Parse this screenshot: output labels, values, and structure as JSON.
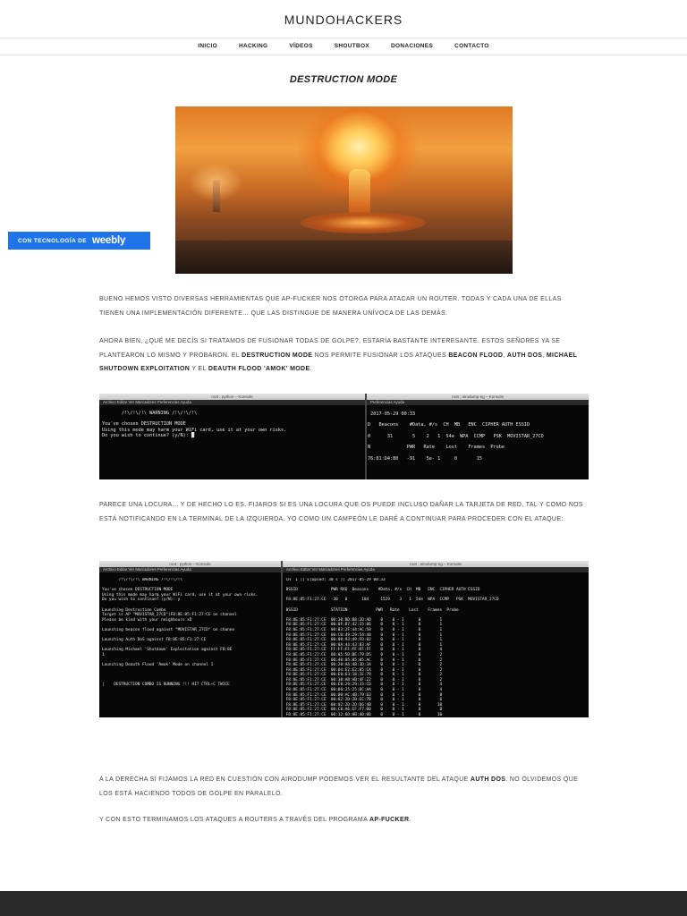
{
  "site": {
    "title": "MUNDOHACKERS"
  },
  "nav": [
    {
      "label": "INICIO"
    },
    {
      "label": "HACKING"
    },
    {
      "label": "VÍDEOS"
    },
    {
      "label": "SHOUTBOX"
    },
    {
      "label": "DONACIONES"
    },
    {
      "label": "CONTACTO"
    }
  ],
  "page": {
    "heading": "DESTRUCTION MODE"
  },
  "badge": {
    "prefix": "CON TECNOLOGÍA DE",
    "brand": "weebly",
    "color": "#1e74e8"
  },
  "paragraphs": {
    "p1": "Bueno hemos visto diversas herramientas que AP-Fucker nos otorga para atacar un router. Todas y cada una de ellas tienen una implementación diferente... que las distingue de manera unívoca de las demás.",
    "p2a": "Ahora bien, ¿qué me decís si tratamos de fusionar todas de golpe?, estaría bastante interesante. Estos señores ya se plantearon lo mismo y probaron. El ",
    "p2b": "Destruction Mode",
    "p2c": " nos permite fusionar los ataques ",
    "p2d": "Beacon Flood",
    "p2e": ", ",
    "p2f": "Auth DoS",
    "p2g": ", ",
    "p2h": "Michael Shutdown Exploitation",
    "p2i": " y el ",
    "p2j": "Deauth Flood 'Amok' Mode",
    "p2k": ".",
    "p3": "Parece una locura... y de hecho lo es. Fijaros si es una locura que os puede incluso dañar la tarjeta de red, tal y como nos está notificando en la terminal de la izquierda. Yo como un campeón le daré a continuar para proceder con el ataque:",
    "p4a": "A la derecha si fijamos la red en cuestión con airodump podemos ver el resultante del ataque ",
    "p4b": "Auth DoS",
    "p4c": ". No olvidemos que los está haciendo todos de golpe en paralelo.",
    "p5a": "Y con esto terminamos los ataques a routers a través del programa ",
    "p5b": "AP-Fucker",
    "p5c": "."
  },
  "term1": {
    "left_title": "root : python – Konsole",
    "right_title": "root : airodump-ng – Konsole",
    "left_menu": "Archivo   Editar   Ver   Marcadores   Preferencias   Ayuda",
    "right_menu": "Preferencias   Ayuda",
    "left_text": "       /!\\/!\\/!\\ WARNING /!\\/!\\/!\\\n\nYou've chosen DESTRUCTION MODE\nUsing this mode may harm your WiFi card, use it at your own risks.\nDo you wish to continue? (y/N): █",
    "right_text": " 2017-05-29 00:33\n\nD   Beacons    #Data, #/s  CH  MB   ENC  CIPHER AUTH ESSID\n\n0      31       5    2   1  54e  WPA  CCMP   PSK  MOVISTAR_27CD\n\nN             PWR   Rate    Lost    Frames  Probe\n\n76:81:D4:B0   -91    5e- 1     0       15"
  },
  "term2": {
    "left_title": "root : python – Konsole",
    "right_title": "root : airodump-ng – Konsole",
    "left_menu": "Archivo   Editar   Ver   Marcadores   Preferencias   Ayuda",
    "right_menu": "Archivo   Editar   Ver   Marcadores   Preferencias   Ayuda",
    "left_text": "       /!\\/!\\/!\\ WARNING /!\\/!\\/!\\\n\nYou've chosen DESTRUCTION MODE\nUsing this mode may harm your WiFi card, use it at your own risks.\nDo you wish to continue? (y/N): y\n\nLaunching Destruction Combo\nTarget is AP \"MOVISTAR_27CD\"(F8:8E:85:F1:27:CE on channel\nPlease be kind with your neighbours xD\n\nLaunching beacon flood against \"MOVISTAR_27CD\" on channe\n\nLaunching Auth DoS against F8:8E:85:F1:27:CE\n\nLaunching Michael 'Shutdown' Exploitation against F8:8E\n1\n\nLaunching Deauth Flood 'Amok' Mode on channel 1\n\n\n\n|    DESTRUCTION COMBO IS RUNNING !!! HIT CTRL+C TWICE",
    "right_text": " CH  1 ][ Elapsed: 30 s ][ 2017-05-29 00:33\n\n BSSID              PWR RXQ  Beacons    #Data, #/s  CH  MB   ENC  CIPHER AUTH ESSID\n\n F8:8E:85:F1:27:CE  -30   0      104     1529    3   1  54e  WPA  CCMP   PSK  MOVISTAR_27CD\n\n BSSID              STATION            PWR   Rate    Lost    Frames  Probe\n\n F8:8E:85:F1:27:CE  00:30:BD:B8:2D:AD    0    0 - 1      0        1\n F8:8E:85:F1:27:CE  00:0F:B7:42:15:06    0    0 - 1      0        1\n F8:8E:85:F1:27:CE  00:03:2F:44:AC:58    0    0 - 1      0        1\n F8:8E:85:F1:27:CE  00:C0:49:29:54:48    0    0 - 1      0        1\n F8:8E:85:F1:27:CE  00:00:93:49:FD:02    0    0 - 1      0        1\n F8:8E:85:F1:27:CE  00:0A:44:43:83:AF    0    0 - 1      0        1\n F8:8E:85:F1:27:CE  FF:FF:FF:FF:FF:FF    0    0 - 1      0        4\n F8:8E:85:F1:27:CE  00:05:5D:BE:79:D5    0    0 - 1      0        2\n F8:8E:85:F1:27:CE  00:40:05:05:05:AC    0    0 - 1      0        2\n F8:8E:85:F1:27:CE  00:20:A6:4B:3D:34    0    0 - 1      0        2\n F8:8E:85:F1:27:CE  00:04:E2:E2:85:CA    0    0 - 1      0        2\n F8:8E:85:F1:27:CE  00:E0:63:18:1E:79    0    0 - 1      0        2\n F8:8E:85:F1:27:CE  00:30:AB:AB:4F:22    0    0 - 1      0        2\n F8:8E:85:F1:27:CE  00:E0:29:29:33:CD    0    0 - 1      0        4\n F8:8E:85:F1:27:CE  00:06:25:25:DC:AA    0    0 - 1      0        4\n F8:8E:85:F1:27:CE  00:00:AC:4B:79:63    0    0 - 1      0        8\n F8:8E:85:F1:27:CE  00:02:2D:2B:EC:78    0    0 - 1      0        6\n F8:8E:85:F1:27:CE  00:02:2D:2D:D6:4B    0    0 - 1      0       10\n F8:8E:85:F1:27:CE  00:C0:A6:EF:F7:00    0    0 - 1      0        8\n F8:8E:85:F1:27:CE  00:12:6D:8B:40:0B    0    0 - 1      0       10"
  }
}
